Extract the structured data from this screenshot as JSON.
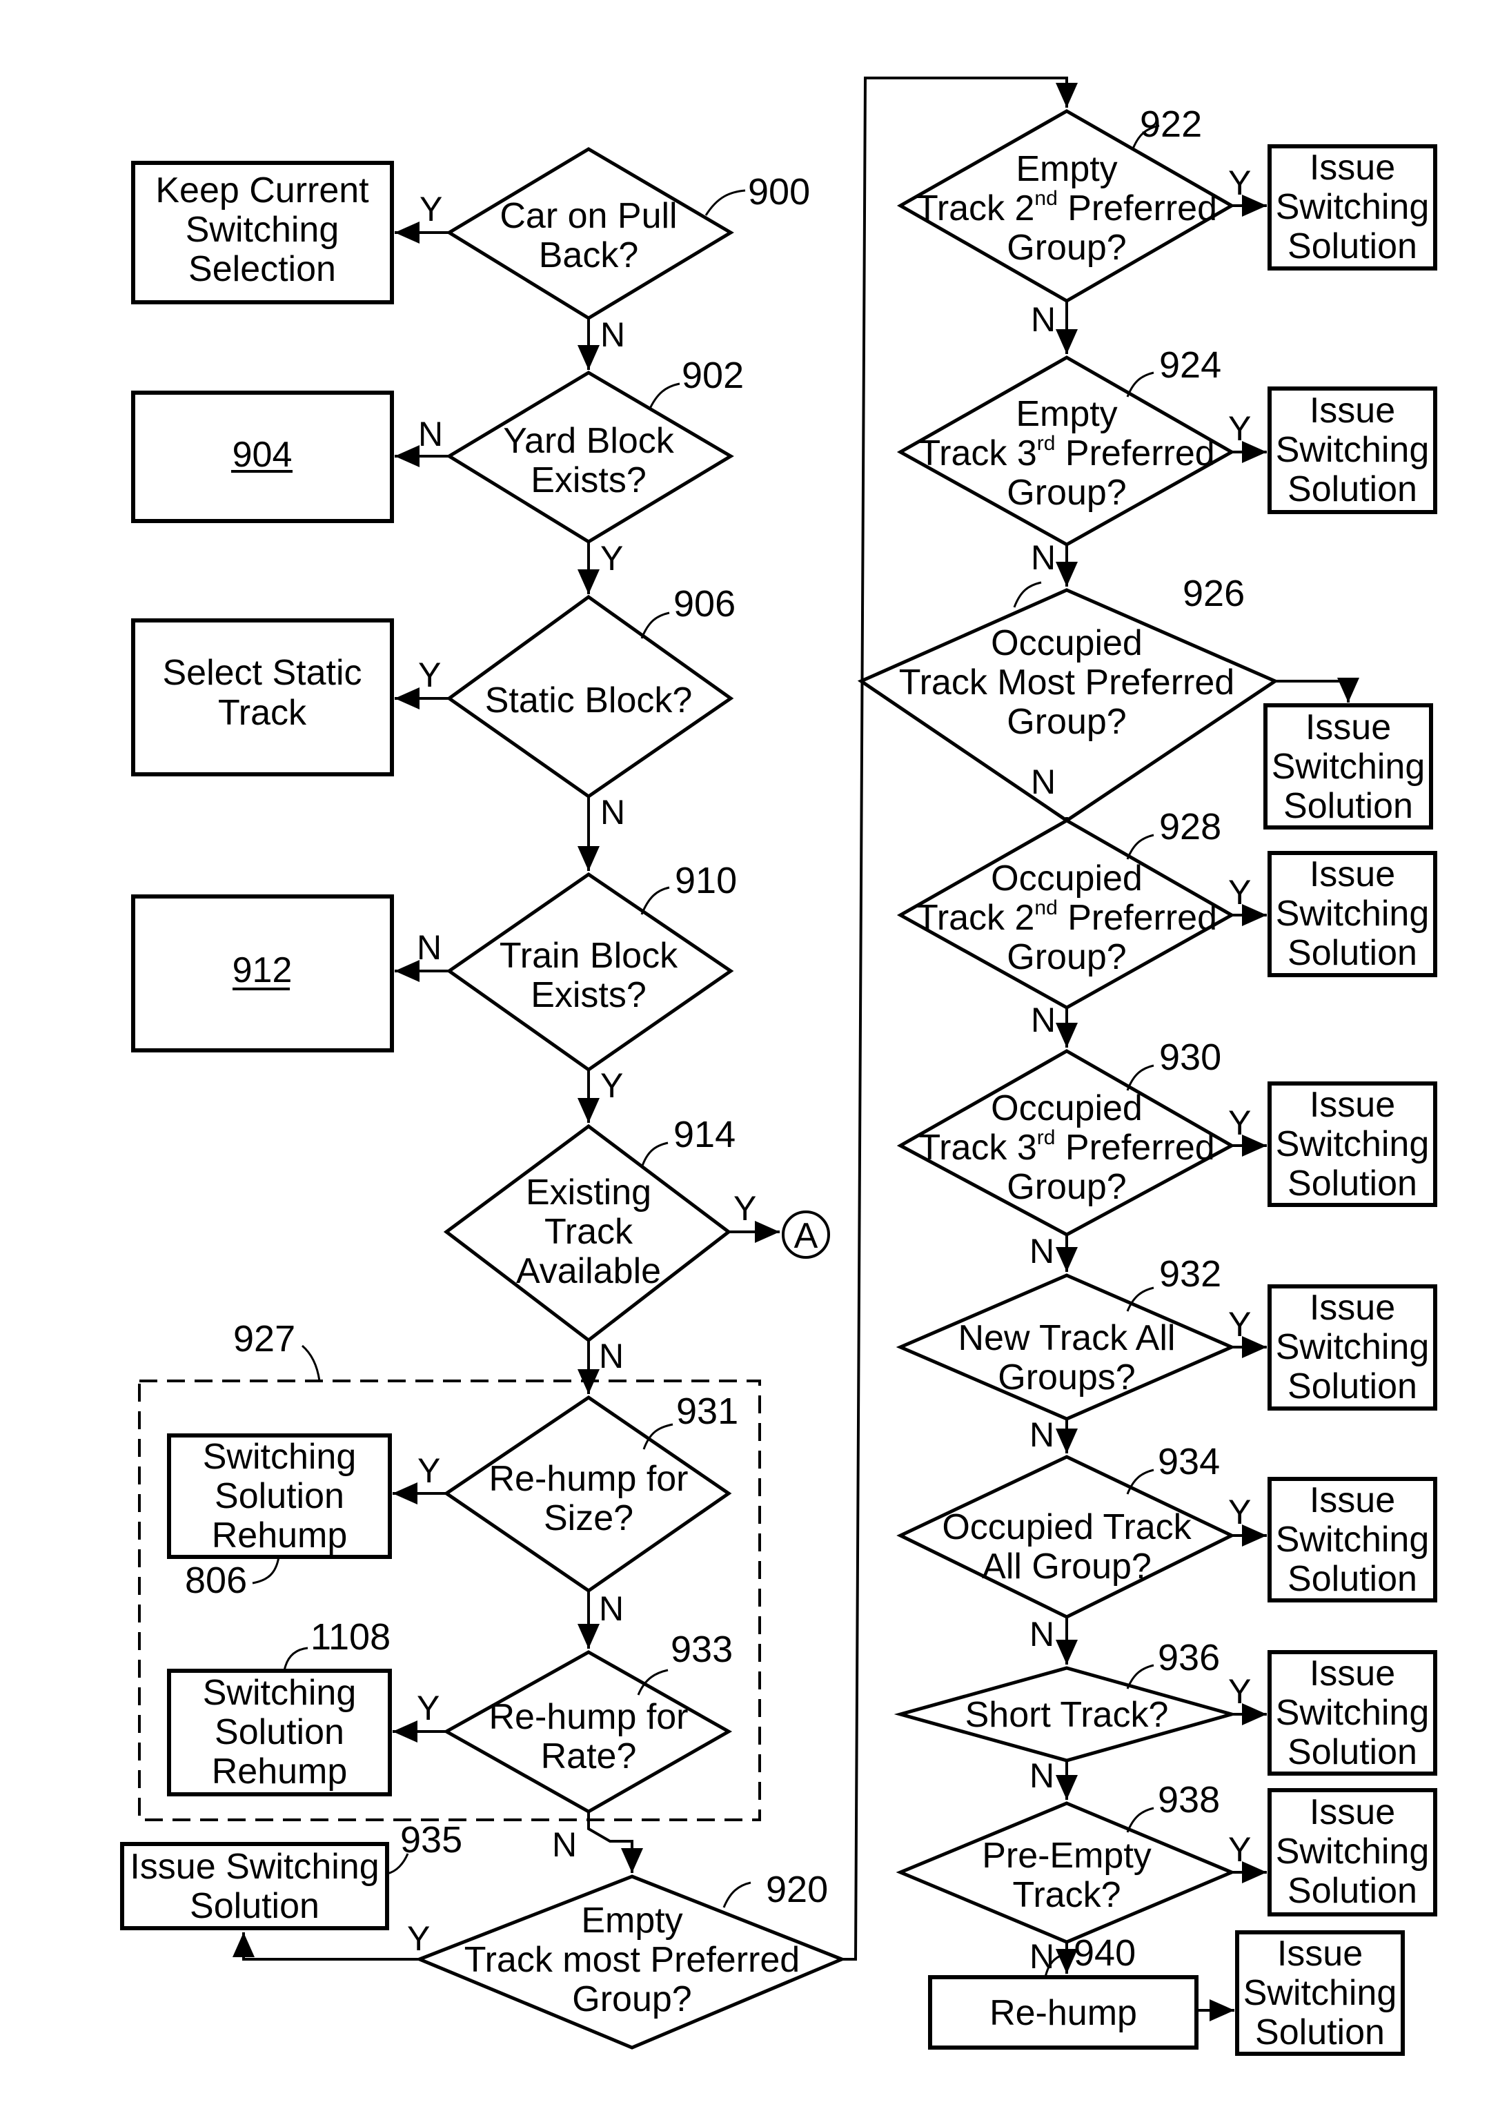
{
  "figure": {
    "type": "flowchart",
    "colors": {
      "ink": "#000000",
      "background": "#ffffff"
    }
  },
  "nodes": {
    "n900": {
      "ref": "900",
      "kind": "decision",
      "lines": [
        "Car on Pull",
        "Back?"
      ]
    },
    "keep": {
      "kind": "process",
      "lines": [
        "Keep Current",
        "Switching",
        "Selection"
      ]
    },
    "n902": {
      "ref": "902",
      "kind": "decision",
      "lines": [
        "Yard Block",
        "Exists?"
      ]
    },
    "n904": {
      "ref": "904",
      "kind": "process",
      "underlined_label": "904"
    },
    "n906": {
      "ref": "906",
      "kind": "decision",
      "lines": [
        "Static Block?"
      ]
    },
    "static": {
      "kind": "process",
      "lines": [
        "Select Static",
        "Track"
      ]
    },
    "n910": {
      "ref": "910",
      "kind": "decision",
      "lines": [
        "Train Block",
        "Exists?"
      ]
    },
    "n912": {
      "ref": "912",
      "kind": "process",
      "underlined_label": "912"
    },
    "n914": {
      "ref": "914",
      "kind": "decision",
      "lines": [
        "Existing",
        "Track",
        "Available"
      ]
    },
    "connectorA": {
      "kind": "connector",
      "label": "A"
    },
    "group927": {
      "ref": "927",
      "kind": "group"
    },
    "n931": {
      "ref": "931",
      "kind": "decision",
      "lines": [
        "Re-hump for",
        "Size?"
      ]
    },
    "n806": {
      "ref": "806",
      "kind": "process",
      "lines": [
        "Switching",
        "Solution",
        "Rehump"
      ]
    },
    "n933": {
      "ref": "933",
      "kind": "decision",
      "lines": [
        "Re-hump for",
        "Rate?"
      ]
    },
    "n1108": {
      "ref": "1108",
      "kind": "process",
      "lines": [
        "Switching",
        "Solution",
        "Rehump"
      ]
    },
    "n935": {
      "ref": "935",
      "kind": "process",
      "lines": [
        "Issue Switching",
        "Solution"
      ]
    },
    "n920": {
      "ref": "920",
      "kind": "decision",
      "lines": [
        "Empty",
        "Track most Preferred",
        "Group?"
      ]
    },
    "n922": {
      "ref": "922",
      "kind": "decision",
      "line1": "Empty",
      "line2_pre": "Track 2",
      "line2_sup": "nd",
      "line2_post": " Preferred",
      "line3": "Group?"
    },
    "n924": {
      "ref": "924",
      "kind": "decision",
      "line1": "Empty",
      "line2_pre": "Track 3",
      "line2_sup": "rd",
      "line2_post": " Preferred",
      "line3": "Group?"
    },
    "n926": {
      "ref": "926",
      "kind": "decision",
      "lines": [
        "Occupied",
        "Track Most Preferred",
        "Group?"
      ]
    },
    "n928": {
      "ref": "928",
      "kind": "decision",
      "line1": "Occupied",
      "line2_pre": "Track 2",
      "line2_sup": "nd",
      "line2_post": " Preferred",
      "line3": "Group?"
    },
    "n930": {
      "ref": "930",
      "kind": "decision",
      "line1": "Occupied",
      "line2_pre": "Track 3",
      "line2_sup": "rd",
      "line2_post": " Preferred",
      "line3": "Group?"
    },
    "n932": {
      "ref": "932",
      "kind": "decision",
      "lines": [
        "New Track All",
        "Groups?"
      ]
    },
    "n934": {
      "ref": "934",
      "kind": "decision",
      "lines": [
        "Occupied Track",
        "All Group?"
      ]
    },
    "n936": {
      "ref": "936",
      "kind": "decision",
      "lines": [
        "Short Track?"
      ]
    },
    "n938": {
      "ref": "938",
      "kind": "decision",
      "lines": [
        "Pre-Empty",
        "Track?"
      ]
    },
    "n940": {
      "ref": "940",
      "kind": "process",
      "lines": [
        "Re-hump"
      ]
    }
  },
  "issue_box": {
    "lines": [
      "Issue",
      "Switching",
      "Solution"
    ]
  },
  "edge_labels": {
    "yes": "Y",
    "no": "N"
  }
}
